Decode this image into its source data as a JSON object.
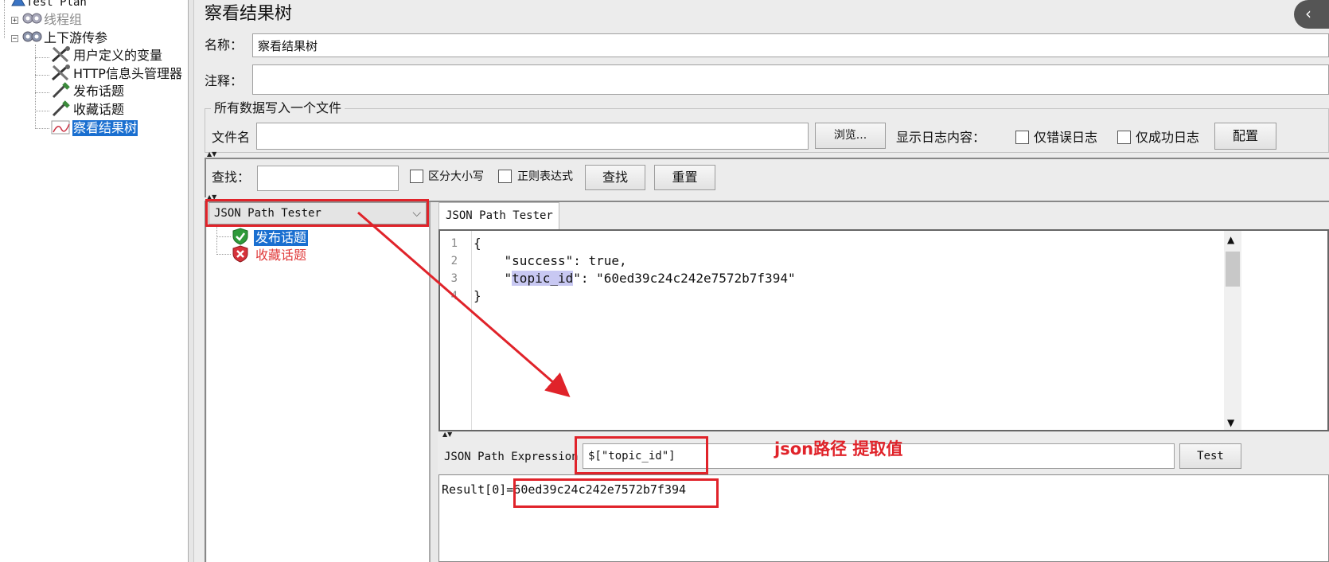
{
  "tree": {
    "test_plan": "Test Plan",
    "thread_group": "线程组",
    "updown_params": "上下游传参",
    "user_vars": "用户定义的变量",
    "http_header": "HTTP信息头管理器",
    "publish_topic": "发布话题",
    "collect_topic": "收藏话题",
    "view_results_tree": "察看结果树"
  },
  "panel": {
    "title": "察看结果树",
    "name_label": "名称：",
    "name_value": "察看结果树",
    "comment_label": "注释：",
    "comment_value": "",
    "file_section_title": "所有数据写入一个文件",
    "filename_label": "文件名",
    "filename_value": "",
    "browse_button": "浏览...",
    "log_display_label": "显示日志内容：",
    "errors_only_label": "仅错误日志",
    "success_only_label": "仅成功日志",
    "config_button": "配置",
    "search_label": "查找：",
    "search_value": "",
    "case_sensitive_label": "区分大小写",
    "regex_label": "正则表达式",
    "find_button": "查找",
    "reset_button": "重置"
  },
  "results": {
    "renderer_selected": "JSON Path Tester",
    "samples": [
      {
        "label": "发布话题",
        "status": "success"
      },
      {
        "label": "收藏话题",
        "status": "error"
      }
    ],
    "tab_label": "JSON Path Tester",
    "response_lines": [
      {
        "num": "1",
        "text": "{"
      },
      {
        "num": "2",
        "text": "    \"success\": true,"
      },
      {
        "num": "3",
        "pre": "    \"",
        "key": "topic_id",
        "post": "\": \"60ed39c24c242e7572b7f394\""
      },
      {
        "num": "4",
        "text": "}"
      }
    ],
    "expression_label": "JSON Path Expression",
    "expression_value": "$[\"topic_id\"]",
    "test_button": "Test",
    "result_prefix": "Result[0]",
    "result_value": "=60ed39c24c242e7572b7f394"
  },
  "annotation": {
    "text": "json路径 提取值",
    "color": "#e0232a"
  },
  "colors": {
    "selection": "#1a6fd0",
    "success": "#2e9a3a",
    "error": "#d6323a"
  }
}
